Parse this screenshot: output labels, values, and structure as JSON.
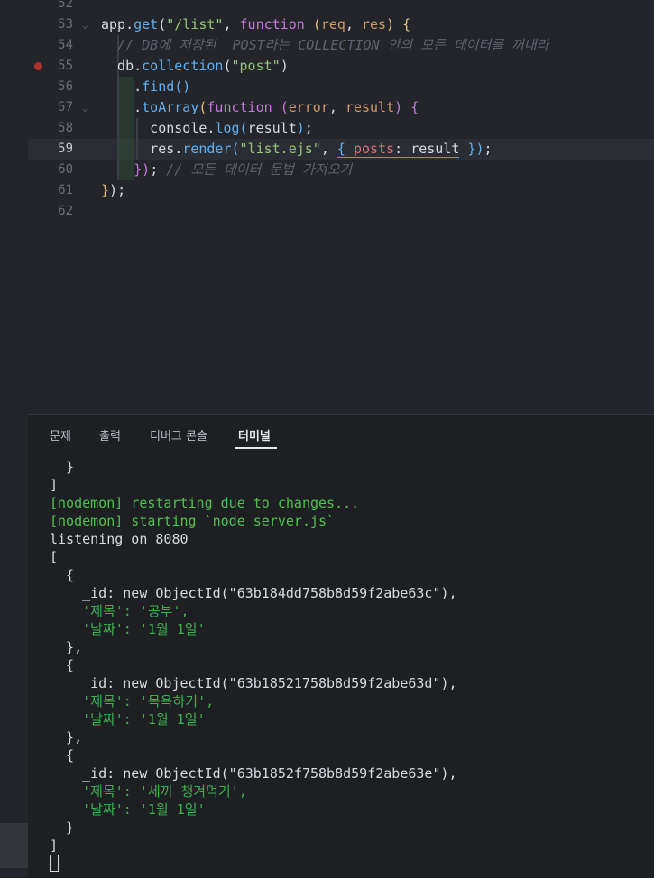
{
  "editor": {
    "lines": [
      {
        "num": "52",
        "tokens": []
      },
      {
        "num": "53",
        "fold": "⌄",
        "tokens": [
          {
            "t": "app",
            "c": "pl"
          },
          {
            "t": ".",
            "c": "pl"
          },
          {
            "t": "get",
            "c": "fn"
          },
          {
            "t": "(",
            "c": "pl"
          },
          {
            "t": "\"/list\"",
            "c": "str"
          },
          {
            "t": ", ",
            "c": "pl"
          },
          {
            "t": "function",
            "c": "kw"
          },
          {
            "t": " ",
            "c": "pl"
          },
          {
            "t": "(",
            "c": "p"
          },
          {
            "t": "req",
            "c": "par"
          },
          {
            "t": ", ",
            "c": "pl"
          },
          {
            "t": "res",
            "c": "par"
          },
          {
            "t": ")",
            "c": "p"
          },
          {
            "t": " ",
            "c": "pl"
          },
          {
            "t": "{",
            "c": "p"
          }
        ]
      },
      {
        "num": "54",
        "tokens": [
          {
            "t": "  // DB에 저장된  POST라는 COLLECTION 안의 모든 데이터를 꺼내라",
            "c": "cm"
          }
        ]
      },
      {
        "num": "55",
        "breakpoint": true,
        "tokens": [
          {
            "t": "  db",
            "c": "pl"
          },
          {
            "t": ".",
            "c": "pl"
          },
          {
            "t": "collection",
            "c": "fn"
          },
          {
            "t": "(",
            "c": "pl"
          },
          {
            "t": "\"post\"",
            "c": "str"
          },
          {
            "t": ")",
            "c": "pl"
          }
        ]
      },
      {
        "num": "56",
        "tokens": [
          {
            "t": "    .",
            "c": "pl"
          },
          {
            "t": "find",
            "c": "fn"
          },
          {
            "t": "()",
            "c": "fn"
          }
        ]
      },
      {
        "num": "57",
        "fold": "⌄",
        "tokens": [
          {
            "t": "    .",
            "c": "pl"
          },
          {
            "t": "toArray",
            "c": "fn"
          },
          {
            "t": "(",
            "c": "p"
          },
          {
            "t": "function",
            "c": "kw"
          },
          {
            "t": " ",
            "c": "pl"
          },
          {
            "t": "(",
            "c": "kw"
          },
          {
            "t": "error",
            "c": "par"
          },
          {
            "t": ", ",
            "c": "pl"
          },
          {
            "t": "result",
            "c": "par"
          },
          {
            "t": ")",
            "c": "kw"
          },
          {
            "t": " ",
            "c": "pl"
          },
          {
            "t": "{",
            "c": "kw"
          }
        ]
      },
      {
        "num": "58",
        "tokens": [
          {
            "t": "      console",
            "c": "pl"
          },
          {
            "t": ".",
            "c": "pl"
          },
          {
            "t": "log",
            "c": "fn"
          },
          {
            "t": "(",
            "c": "fn"
          },
          {
            "t": "result",
            "c": "pl"
          },
          {
            "t": ")",
            "c": "fn"
          },
          {
            "t": ";",
            "c": "pl"
          }
        ]
      },
      {
        "num": "59",
        "current": true,
        "tokens": [
          {
            "t": "      res",
            "c": "pl"
          },
          {
            "t": ".",
            "c": "pl"
          },
          {
            "t": "render",
            "c": "fn"
          },
          {
            "t": "(",
            "c": "fn"
          },
          {
            "t": "\"list.ejs\"",
            "c": "str"
          },
          {
            "t": ", ",
            "c": "pl"
          },
          {
            "t": "{ ",
            "c": "fn",
            "u": true
          },
          {
            "t": "posts",
            "c": "prop",
            "u": true
          },
          {
            "t": ": ",
            "c": "pl",
            "u": true
          },
          {
            "t": "result",
            "c": "pl",
            "u": true
          },
          {
            "t": " }",
            "c": "fn"
          },
          {
            "t": ")",
            "c": "fn"
          },
          {
            "t": ";",
            "c": "pl"
          }
        ]
      },
      {
        "num": "60",
        "tokens": [
          {
            "t": "    ",
            "c": "pl"
          },
          {
            "t": "})",
            "c": "kw"
          },
          {
            "t": ";",
            "c": "pl"
          },
          {
            "t": " // 모든 데이터 문법 가져오기",
            "c": "cm"
          }
        ]
      },
      {
        "num": "61",
        "tokens": [
          {
            "t": "}",
            "c": "p"
          },
          {
            "t": ")",
            "c": "pl"
          },
          {
            "t": ";",
            "c": "pl"
          }
        ]
      },
      {
        "num": "62",
        "tokens": []
      }
    ]
  },
  "panel": {
    "tabs": [
      {
        "label": "문제",
        "active": false
      },
      {
        "label": "출력",
        "active": false
      },
      {
        "label": "디버그 콘솔",
        "active": false
      },
      {
        "label": "터미널",
        "active": true
      }
    ],
    "terminal": [
      {
        "text": "  }",
        "c": ""
      },
      {
        "text": "]",
        "c": ""
      },
      {
        "text": "[nodemon] restarting due to changes...",
        "c": "g"
      },
      {
        "text": "[nodemon] starting `node server.js`",
        "c": "g"
      },
      {
        "text": "listening on 8080",
        "c": ""
      },
      {
        "text": "[",
        "c": ""
      },
      {
        "text": "  {",
        "c": ""
      },
      {
        "text": "    _id: new ObjectId(\"63b184dd758b8d59f2abe63c\"),",
        "c": ""
      },
      {
        "text": "    '제목': '공부',",
        "c": "gr"
      },
      {
        "text": "    '날짜': '1월 1일'",
        "c": "gr"
      },
      {
        "text": "  },",
        "c": ""
      },
      {
        "text": "  {",
        "c": ""
      },
      {
        "text": "    _id: new ObjectId(\"63b18521758b8d59f2abe63d\"),",
        "c": ""
      },
      {
        "text": "    '제목': '목욕하기',",
        "c": "gr"
      },
      {
        "text": "    '날짜': '1월 1일'",
        "c": "gr"
      },
      {
        "text": "  },",
        "c": ""
      },
      {
        "text": "  {",
        "c": ""
      },
      {
        "text": "    _id: new ObjectId(\"63b1852f758b8d59f2abe63e\"),",
        "c": ""
      },
      {
        "text": "    '제목': '세끼 챙겨먹기',",
        "c": "gr"
      },
      {
        "text": "    '날짜': '1월 1일'",
        "c": "gr"
      },
      {
        "text": "  }",
        "c": ""
      },
      {
        "text": "]",
        "c": ""
      }
    ]
  },
  "colors": {
    "keyword": "#c678dd",
    "function": "#61afef",
    "string": "#98c379",
    "comment": "#5c6370",
    "terminal_green": "#4ec24e"
  },
  "icons": {
    "fold": "chevron-down-icon",
    "breakpoint": "breakpoint-dot-icon",
    "terminal_cursor": "terminal-cursor-icon"
  }
}
